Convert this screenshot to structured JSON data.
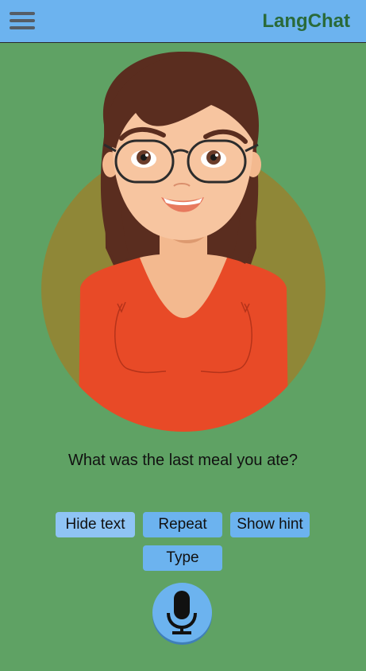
{
  "app": {
    "title": "LangChat"
  },
  "colors": {
    "background": "#5fa264",
    "header": "#6cb3ef",
    "brand_text": "#2a6a3a",
    "button": "#6cb3ef",
    "button_active": "#8fc4f4"
  },
  "icons": {
    "menu": "hamburger-menu-icon",
    "mic": "microphone-icon"
  },
  "conversation": {
    "prompt": "What was the last meal you ate?"
  },
  "buttons": {
    "hide_text": "Hide text",
    "repeat": "Repeat",
    "show_hint": "Show hint",
    "type": "Type"
  }
}
